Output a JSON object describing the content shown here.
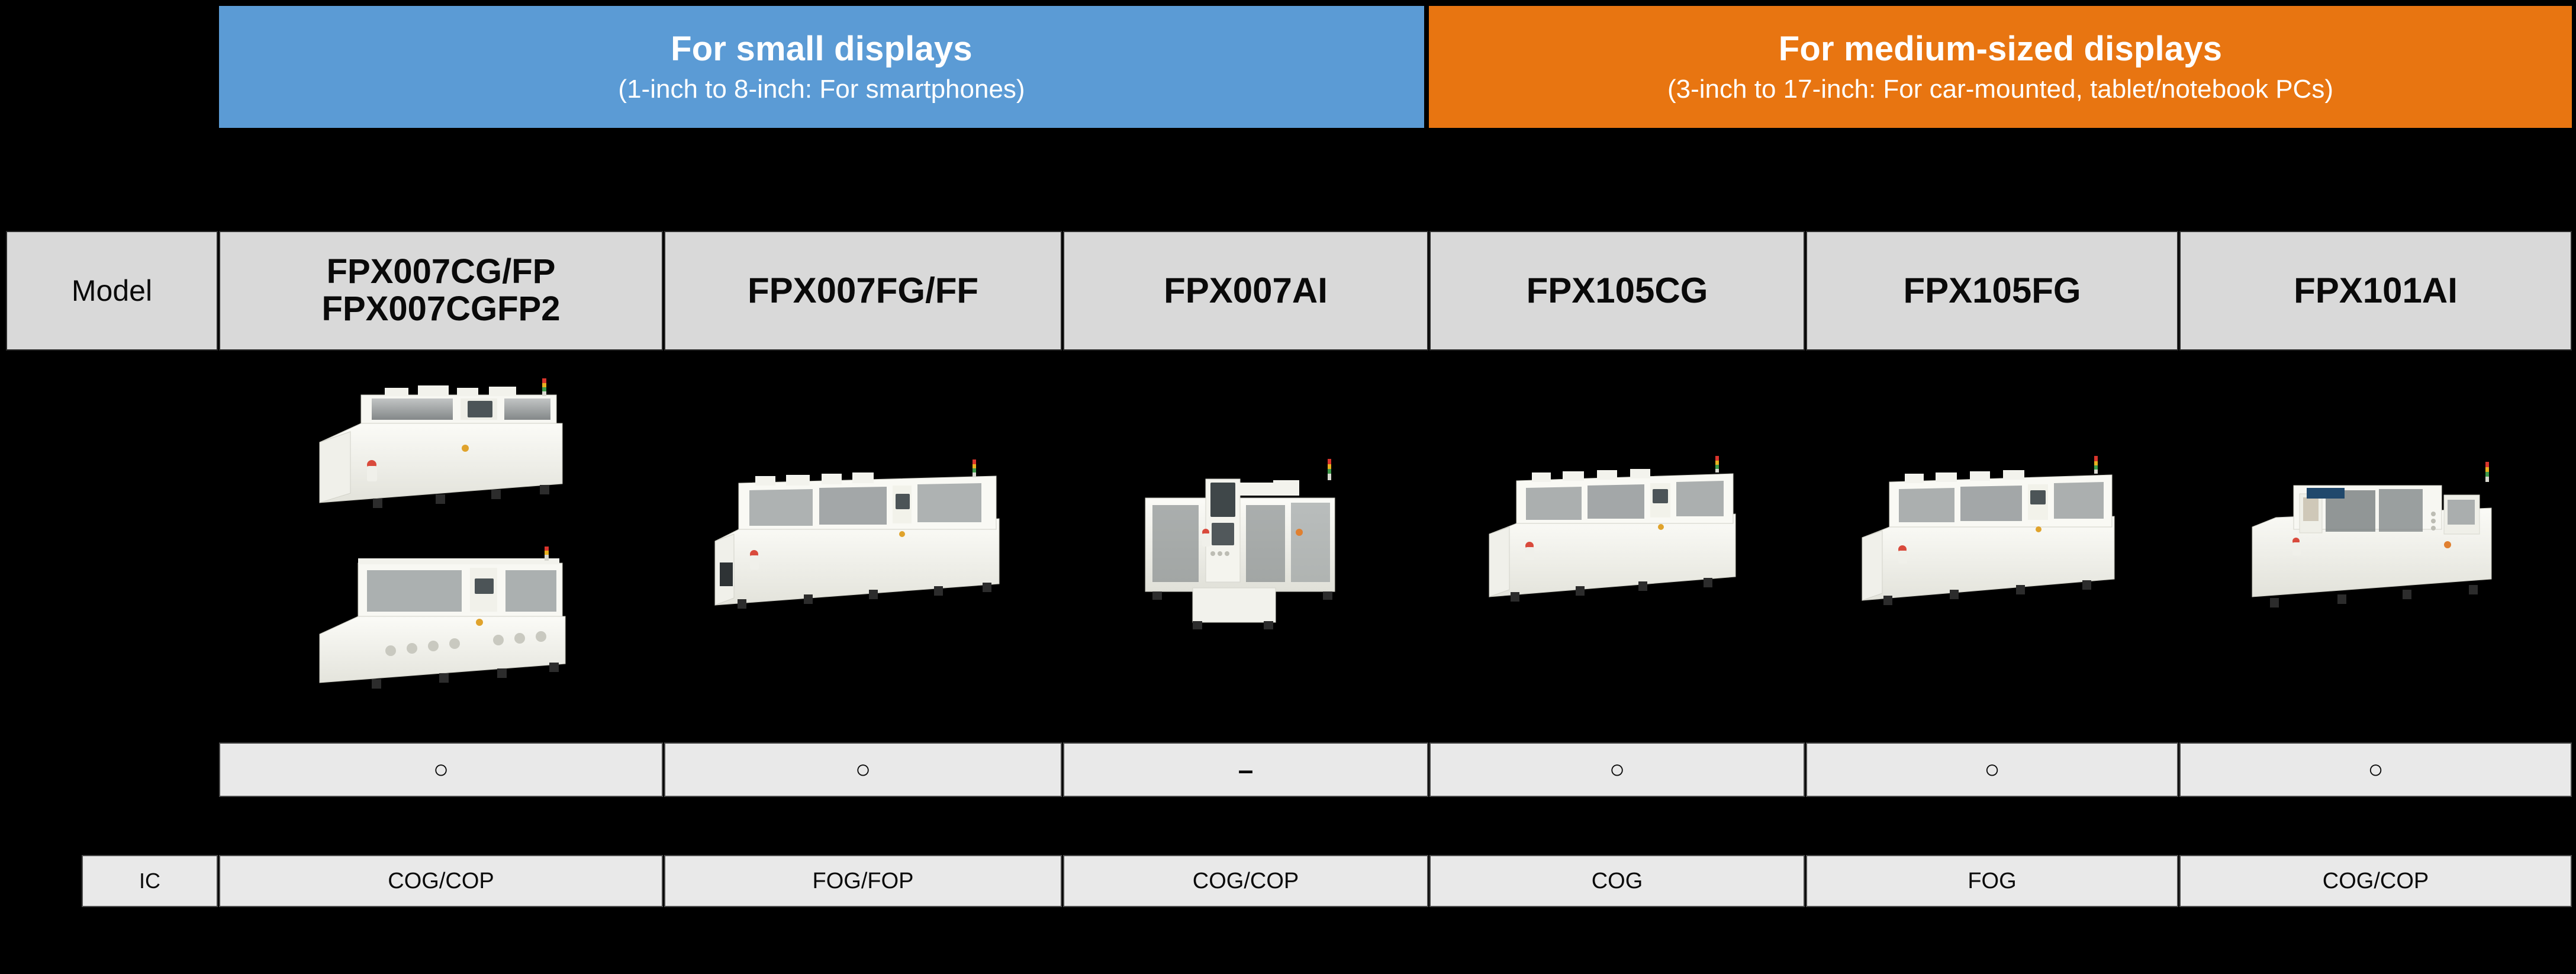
{
  "background_color": "#000000",
  "banners": [
    {
      "id": "small",
      "title": "For small displays",
      "subtitle": "(1-inch to 8-inch: For smartphones)",
      "color": "#5b9bd5"
    },
    {
      "id": "medium",
      "title": "For medium-sized displays",
      "subtitle": "(3-inch to 17-inch: For car-mounted, tablet/notebook PCs)",
      "color": "#e87511"
    }
  ],
  "rows": {
    "model": {
      "label": "Model",
      "values": [
        "FPX007CG/FP\nFPX007CGFP2",
        "FPX007FG/FF",
        "FPX007AI",
        "FPX105CG",
        "FPX105FG",
        "FPX101AI"
      ]
    },
    "support": {
      "label": "",
      "values": [
        "○",
        "○",
        "–",
        "○",
        "○",
        "○"
      ]
    },
    "ic": {
      "label": "IC",
      "values": [
        "COG/COP",
        "FOG/FOP",
        "COG/COP",
        "COG",
        "FOG",
        "COG/COP"
      ]
    }
  },
  "photos": [
    {
      "alt": "bonder-machine-fpx007cg",
      "count": 2
    },
    {
      "alt": "bonder-machine-fpx007fg",
      "count": 1
    },
    {
      "alt": "bonder-machine-fpx007ai",
      "count": 1
    },
    {
      "alt": "bonder-machine-fpx105cg",
      "count": 1
    },
    {
      "alt": "bonder-machine-fpx105fg",
      "count": 1
    },
    {
      "alt": "bonder-machine-fpx101ai",
      "count": 1
    }
  ],
  "colors": {
    "header_cell_bg": "#d9d9d9",
    "data_cell_bg": "#e9e9e9",
    "cell_border": "#3a3a3a",
    "text": "#0a0a0a"
  }
}
